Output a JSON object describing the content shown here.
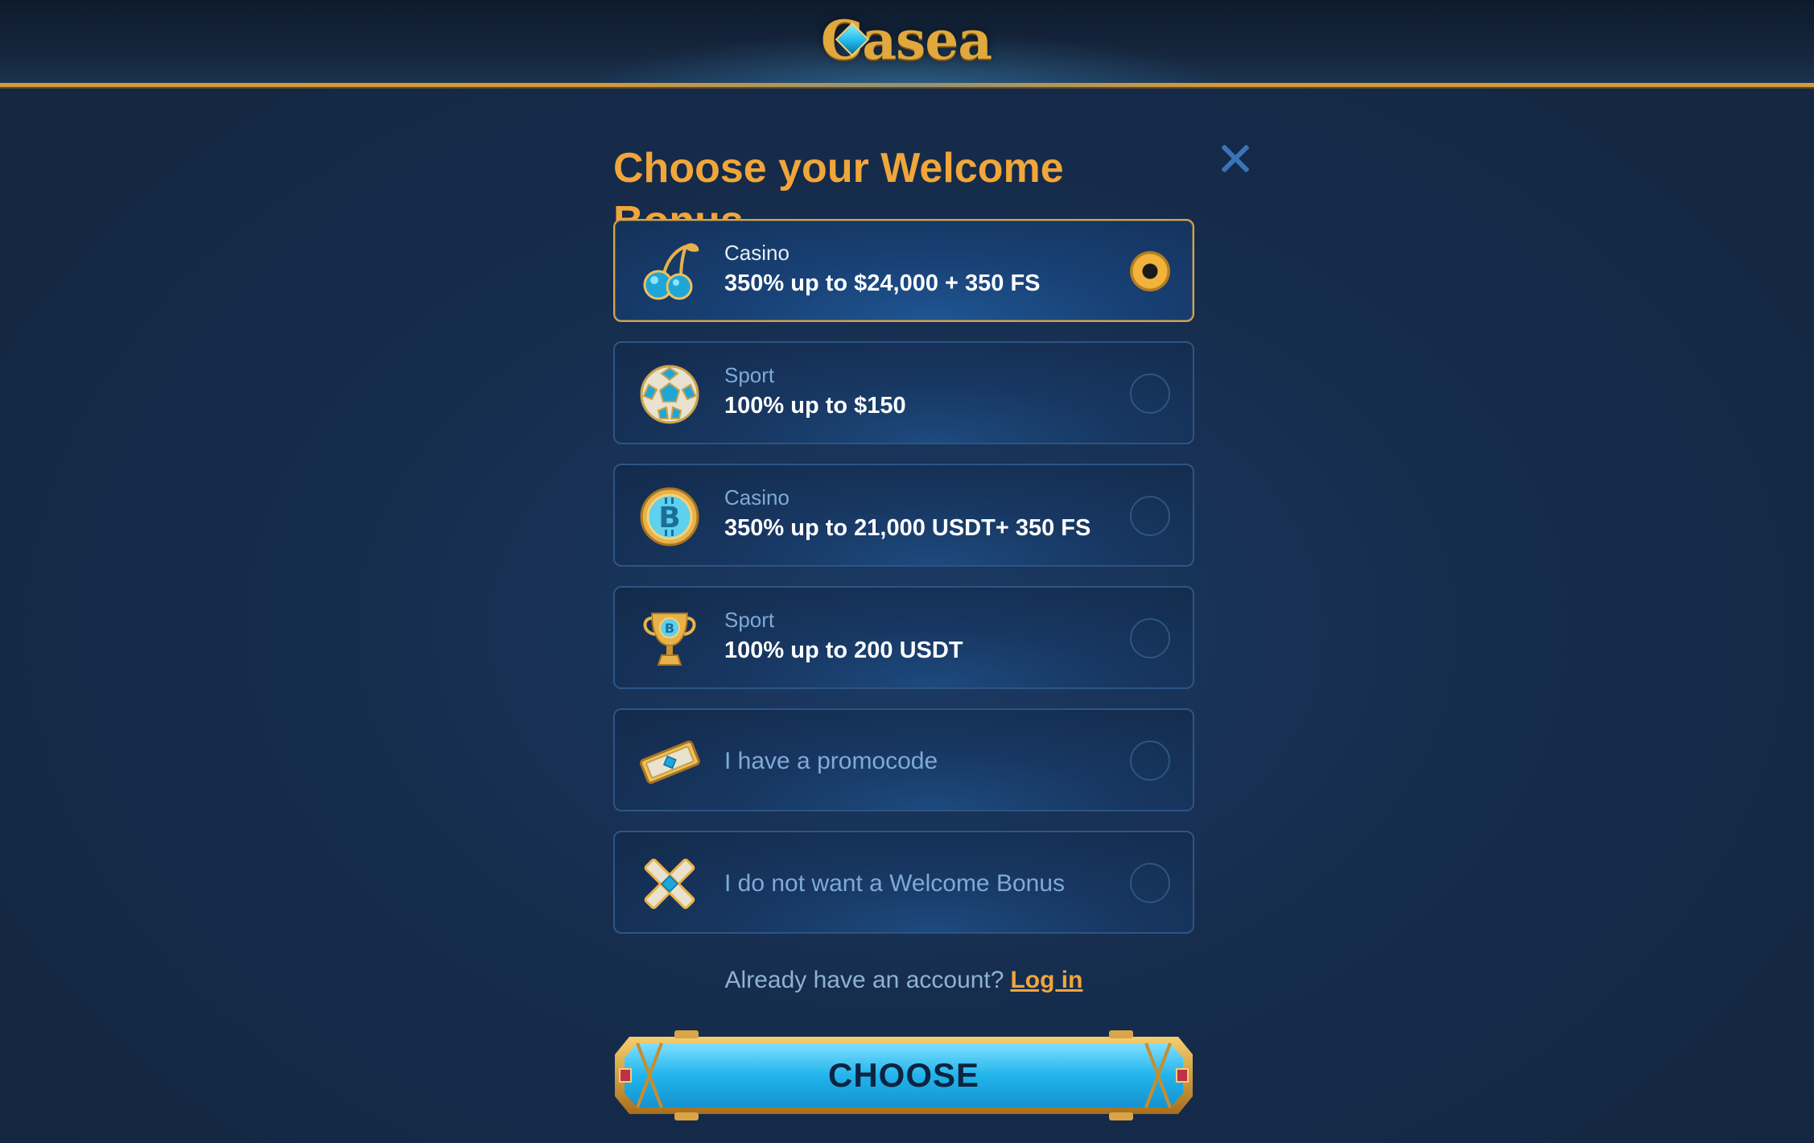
{
  "header": {
    "logo_text": "Casea"
  },
  "modal": {
    "title": "Choose your Welcome Bonus",
    "close_icon": "close-icon",
    "options": [
      {
        "id": "casino-fiat",
        "icon": "cherries-icon",
        "category": "Casino",
        "value": "350% up to $24,000 + 350 FS",
        "selected": true
      },
      {
        "id": "sport-fiat",
        "icon": "soccer-ball-icon",
        "category": "Sport",
        "value": "100% up to $150",
        "selected": false
      },
      {
        "id": "casino-crypto",
        "icon": "bitcoin-coin-icon",
        "category": "Casino",
        "value": "350% up to 21,000 USDT+ 350 FS",
        "selected": false
      },
      {
        "id": "sport-crypto",
        "icon": "trophy-icon",
        "category": "Sport",
        "value": "100% up to 200 USDT",
        "selected": false
      },
      {
        "id": "promocode",
        "icon": "ticket-icon",
        "label": "I have a promocode",
        "selected": false
      },
      {
        "id": "no-bonus",
        "icon": "cross-icon",
        "label": "I do not want a Welcome Bonus",
        "selected": false
      }
    ],
    "login_prompt": "Already have an account?",
    "login_link": "Log in",
    "choose_label": "CHOOSE"
  },
  "colors": {
    "accent": "#f0a63a",
    "background": "#162a47",
    "border": "#2d5584",
    "button": "#1ab4e6"
  }
}
